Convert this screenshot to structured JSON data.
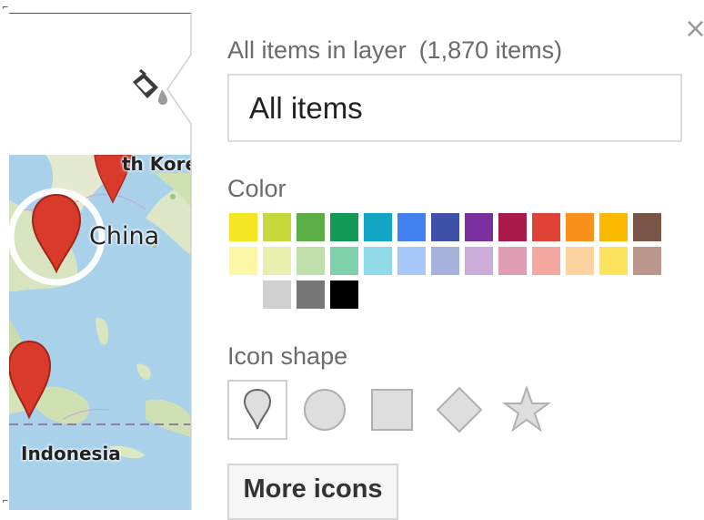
{
  "panel": {
    "layer_title": "All items in layer",
    "item_count": "(1,870 items)",
    "name_value": "All items",
    "color_label": "Color",
    "shape_label": "Icon shape",
    "more_icons_label": "More icons",
    "close_symbol": "×"
  },
  "map": {
    "labels": {
      "china": "China",
      "korea": "th Kore",
      "indonesia": "Indonesia"
    },
    "marker_color": "#d93a2b"
  },
  "colors": {
    "row1": [
      "#f4e622",
      "#c6d83a",
      "#5cad46",
      "#139a57",
      "#12a5c6",
      "#4282f0",
      "#3f51a8",
      "#7b2f9c",
      "#a91a4a",
      "#df4137",
      "#f8921c",
      "#fcb902",
      "#795548"
    ],
    "row2": [
      "#fdf6a6",
      "#e9efac",
      "#bfdfac",
      "#7ed1aa",
      "#91dbe8",
      "#a8c8fa",
      "#a6b2dc",
      "#cdacd9",
      "#df9db3",
      "#f4a8a0",
      "#fdd3a0",
      "#fde25c",
      "#bb968d"
    ],
    "row3": [
      "#d0d0d0",
      "#777777",
      "#000000"
    ]
  },
  "shapes": [
    {
      "name": "pin",
      "selected": true
    },
    {
      "name": "circle",
      "selected": false
    },
    {
      "name": "square",
      "selected": false
    },
    {
      "name": "diamond",
      "selected": false
    },
    {
      "name": "star",
      "selected": false
    }
  ]
}
